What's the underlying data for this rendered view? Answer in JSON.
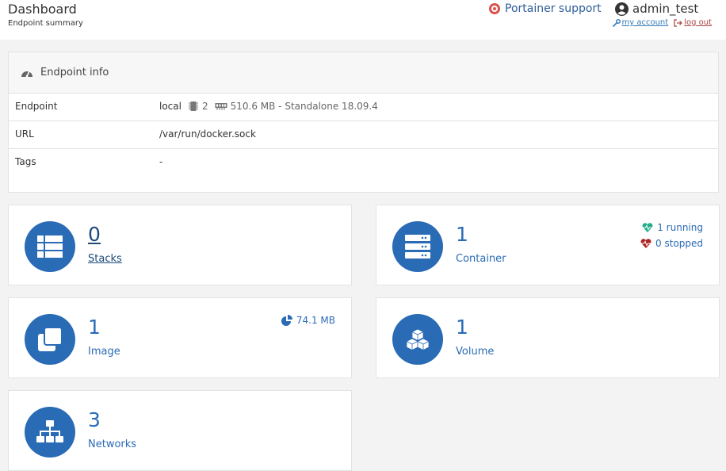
{
  "header": {
    "title": "Dashboard",
    "subtitle": "Endpoint summary",
    "support_label": "Portainer support",
    "username": "admin_test",
    "my_account": "my account",
    "log_out": "log out"
  },
  "endpoint_info": {
    "title": "Endpoint info",
    "rows": [
      {
        "label": "Endpoint",
        "value": "local",
        "cpu": "2",
        "memory": "510.6 MB - Standalone 18.09.4"
      },
      {
        "label": "URL",
        "value": "/var/run/docker.sock"
      },
      {
        "label": "Tags",
        "value": "-"
      }
    ]
  },
  "tiles": {
    "stacks": {
      "count": "0",
      "label": "Stacks"
    },
    "containers": {
      "count": "1",
      "label": "Container",
      "running": "1 running",
      "stopped": "0 stopped"
    },
    "images": {
      "count": "1",
      "label": "Image",
      "size": "74.1 MB"
    },
    "volumes": {
      "count": "1",
      "label": "Volume"
    },
    "networks": {
      "count": "3",
      "label": "Networks"
    }
  },
  "colors": {
    "accent": "#2a6bb6",
    "running": "#23ae89",
    "stopped": "#ae2323",
    "support": "#d9534f"
  }
}
